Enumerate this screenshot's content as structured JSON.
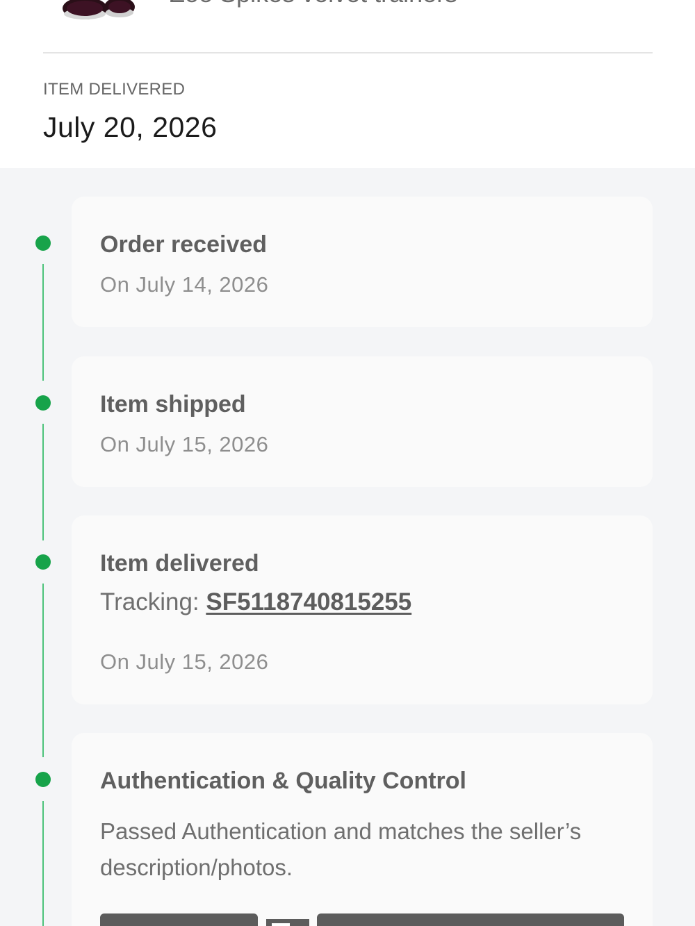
{
  "item": {
    "title": "Zoe Spikes velvet trainers"
  },
  "delivery": {
    "label": "ITEM DELIVERED",
    "date": "July 20, 2026"
  },
  "timeline": {
    "accent_color": "#17a34a",
    "steps": [
      {
        "title": "Order received",
        "date": "On July 14, 2026"
      },
      {
        "title": "Item shipped",
        "date": "On July 15, 2026"
      },
      {
        "title": "Item delivered",
        "tracking_label": "Tracking:",
        "tracking_number": "SF5118740815255",
        "date": "On July 15, 2026"
      },
      {
        "title": "Authentication & Quality Control",
        "description": "Passed Authentication and matches the seller’s description/photos."
      }
    ]
  }
}
